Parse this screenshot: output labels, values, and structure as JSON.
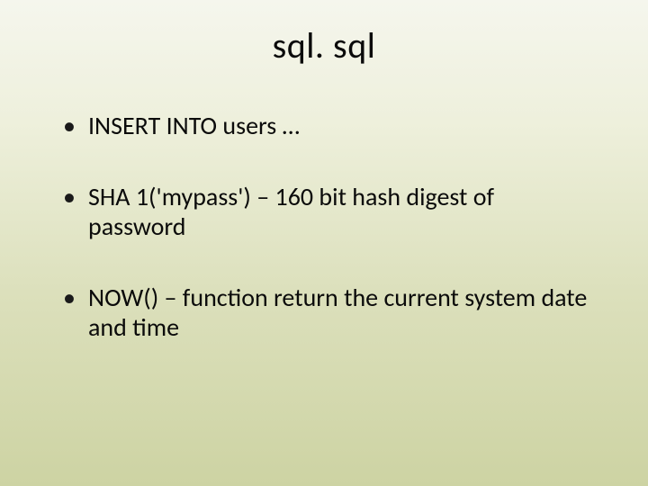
{
  "title": "sql. sql",
  "bullets": [
    "INSERT INTO users …",
    "SHA 1('mypass') – 160 bit hash digest of password",
    " NOW() – function return the current system date and time"
  ]
}
